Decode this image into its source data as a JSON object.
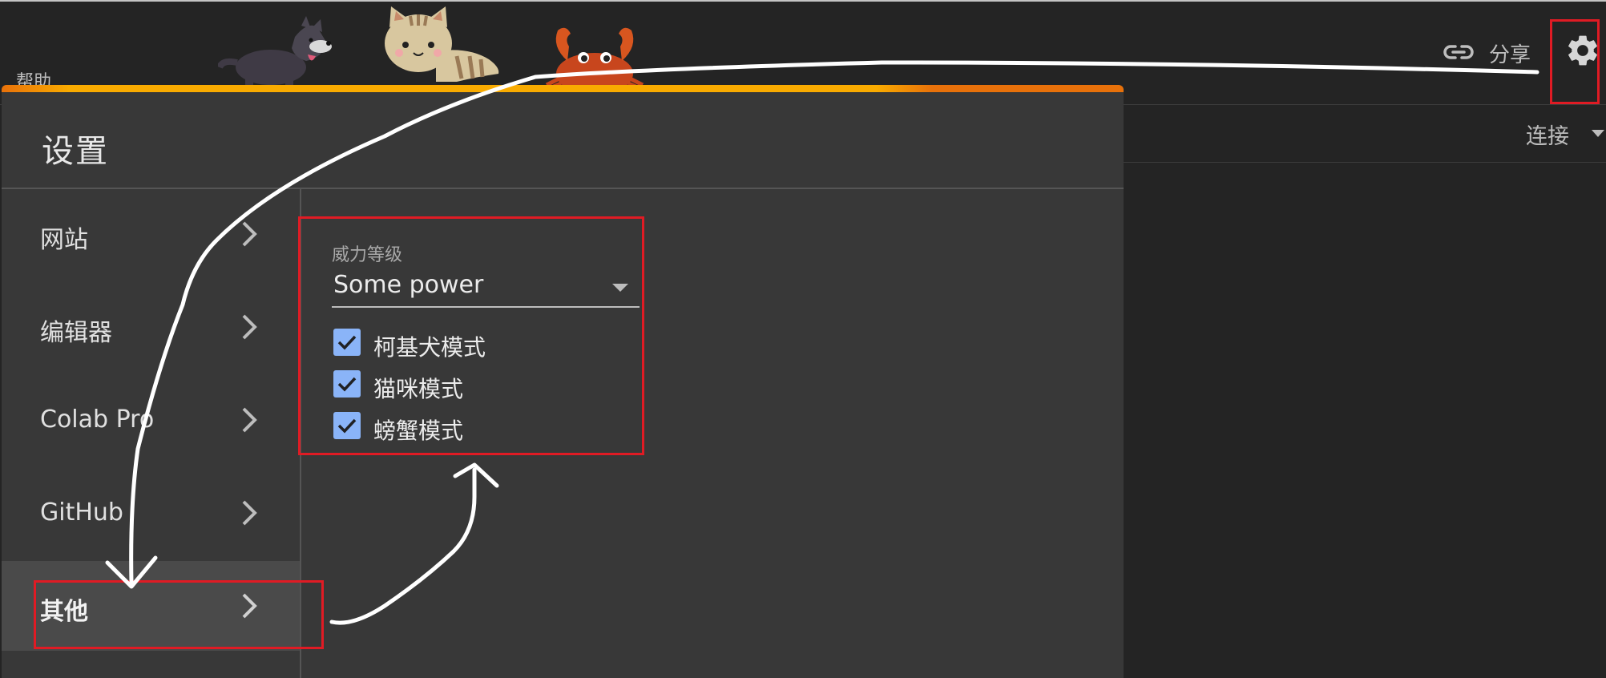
{
  "colors": {
    "accent_orange": "#e8710a",
    "accent_yellow": "#f9ab00",
    "checkbox_blue": "#8ab4f8",
    "annotation_red": "#e01b24",
    "annotation_stroke": "#ffffff"
  },
  "menu": {
    "help_label": "帮助"
  },
  "mascots": [
    "corgi-mascot",
    "cat-mascot",
    "crab-mascot"
  ],
  "header": {
    "link_icon": "link-icon",
    "share_label": "分享",
    "settings_icon": "gear-icon"
  },
  "toolbar": {
    "connect_label": "连接"
  },
  "settings_dialog": {
    "title": "设置",
    "nav_items": [
      {
        "label": "网站",
        "active": false
      },
      {
        "label": "编辑器",
        "active": false
      },
      {
        "label": "Colab Pro",
        "active": false
      },
      {
        "label": "GitHub",
        "active": false
      },
      {
        "label": "其他",
        "active": true
      }
    ],
    "power_level": {
      "label": "威力等级",
      "selected": "Some power"
    },
    "modes": [
      {
        "label": "柯基犬模式",
        "checked": true
      },
      {
        "label": "猫咪模式",
        "checked": true
      },
      {
        "label": "螃蟹模式",
        "checked": true
      }
    ]
  }
}
